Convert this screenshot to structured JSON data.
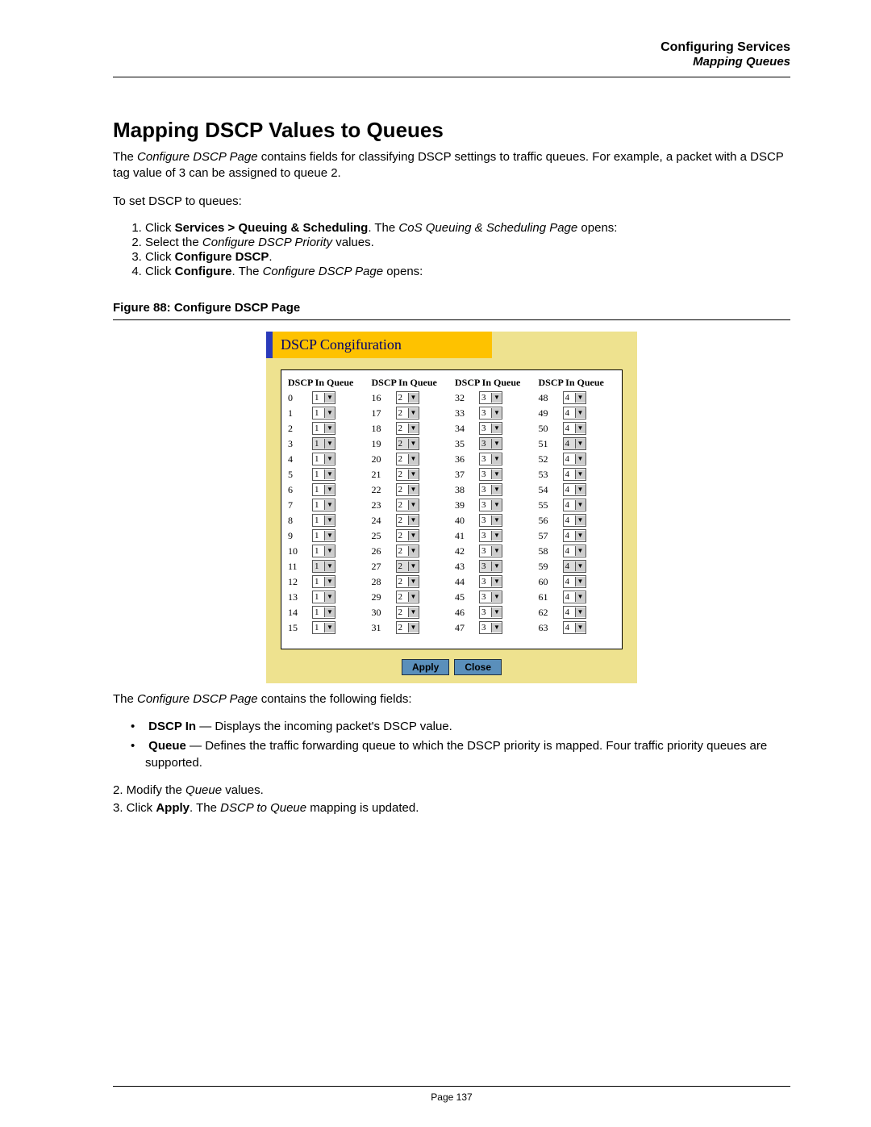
{
  "header": {
    "chapter": "Configuring Services",
    "section": "Mapping Queues"
  },
  "title": "Mapping DSCP Values to Queues",
  "intro1a": "The ",
  "intro1b": "Configure DSCP Page",
  "intro1c": " contains fields for classifying DSCP settings to traffic queues. For example, a packet with a DSCP tag value of 3 can be assigned to queue 2.",
  "intro2": "To set DSCP to queues:",
  "steps": {
    "s1a": "Click ",
    "s1b": "Services > Queuing & Scheduling",
    "s1c": ". The ",
    "s1d": "CoS Queuing & Scheduling Page",
    "s1e": " opens:",
    "s2a": "Select the ",
    "s2b": "Configure DSCP Priority",
    "s2c": " values.",
    "s3a": "Click ",
    "s3b": "Configure DSCP",
    "s3c": ".",
    "s4a": "Click ",
    "s4b": "Configure",
    "s4c": ". The ",
    "s4d": "Configure DSCP Page",
    "s4e": " opens:"
  },
  "figure_caption": "Figure 88:  Configure DSCP Page",
  "screenshot": {
    "title": "DSCP Congifuration",
    "col_header": "DSCP In Queue",
    "apply": "Apply",
    "close": "Close",
    "cols": [
      {
        "queue": "1",
        "disabled_rows": [
          3,
          11
        ],
        "rows": [
          0,
          1,
          2,
          3,
          4,
          5,
          6,
          7,
          8,
          9,
          10,
          11,
          12,
          13,
          14,
          15
        ]
      },
      {
        "queue": "2",
        "disabled_rows": [
          3,
          11
        ],
        "rows": [
          16,
          17,
          18,
          19,
          20,
          21,
          22,
          23,
          24,
          25,
          26,
          27,
          28,
          29,
          30,
          31
        ]
      },
      {
        "queue": "3",
        "disabled_rows": [
          3,
          11
        ],
        "rows": [
          32,
          33,
          34,
          35,
          36,
          37,
          38,
          39,
          40,
          41,
          42,
          43,
          44,
          45,
          46,
          47
        ]
      },
      {
        "queue": "4",
        "disabled_rows": [
          3,
          11
        ],
        "rows": [
          48,
          49,
          50,
          51,
          52,
          53,
          54,
          55,
          56,
          57,
          58,
          59,
          60,
          61,
          62,
          63
        ]
      }
    ]
  },
  "after1a": "The ",
  "after1b": "Configure DSCP Page",
  "after1c": " contains the following fields:",
  "bullet1a": "DSCP In",
  "bullet1b": " — Displays the incoming packet's DSCP value.",
  "bullet2a": "Queue",
  "bullet2b": " — Defines the traffic forwarding queue to which the DSCP priority is mapped. Four traffic priority queues are supported.",
  "post1a": "2. Modify the ",
  "post1b": "Queue",
  "post1c": " values.",
  "post2a": "3. Click ",
  "post2b": "Apply",
  "post2c": ". The ",
  "post2d": "DSCP to Queue",
  "post2e": " mapping is updated.",
  "page_number": "Page 137"
}
